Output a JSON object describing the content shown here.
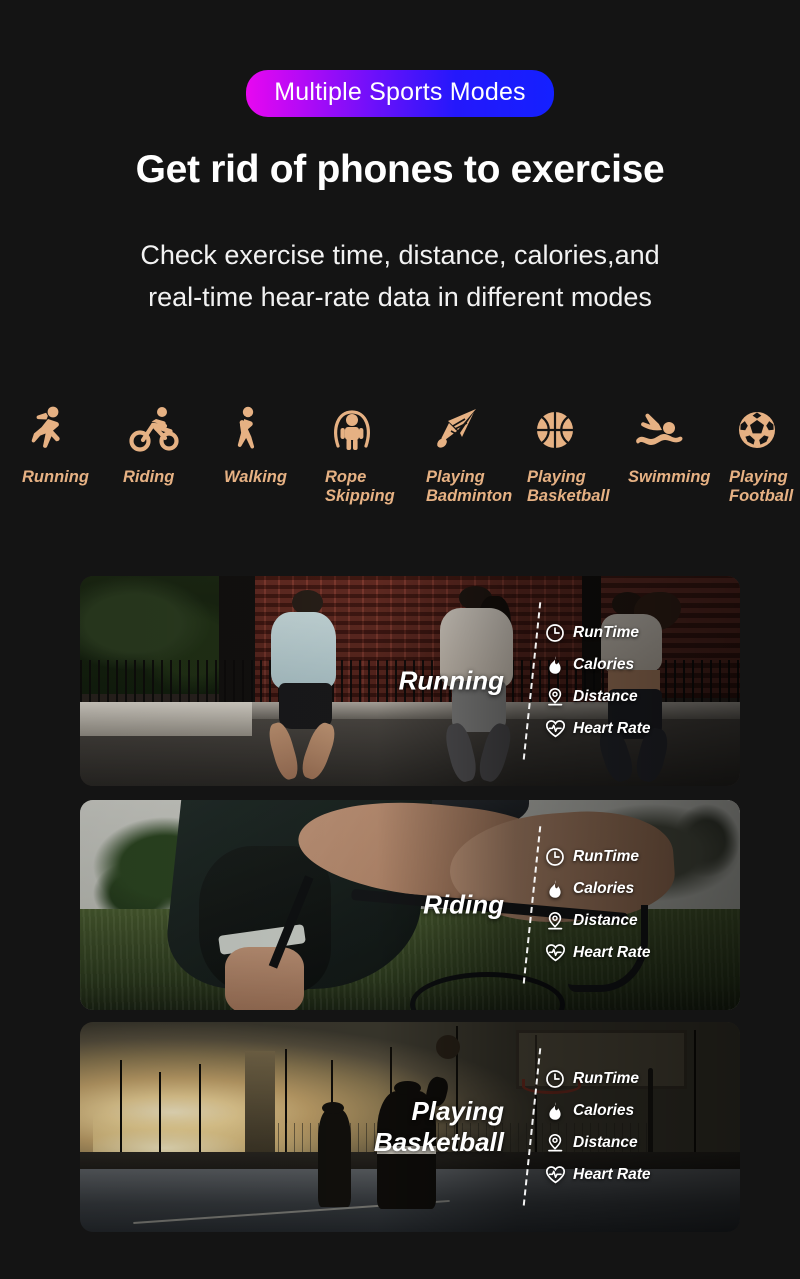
{
  "page": {
    "background_color": "#141414",
    "badge": {
      "label": "Multiple Sports Modes",
      "gradient_from": "#e808f0",
      "gradient_to": "#1420ff",
      "text_color": "#ffffff"
    },
    "headline": "Get rid of phones to exercise",
    "subhead_line1": "Check exercise time, distance, calories,and",
    "subhead_line2": "real-time hear-rate data in different modes",
    "accent_color": "#e6b183"
  },
  "sports": [
    {
      "label": "Running",
      "icon": "running-icon"
    },
    {
      "label": "Riding",
      "icon": "cycling-icon"
    },
    {
      "label": "Walking",
      "icon": "walking-icon"
    },
    {
      "label": "Rope\nSkipping",
      "icon": "rope-skipping-icon"
    },
    {
      "label": "Playing\nBadminton",
      "icon": "badminton-shuttlecock-icon"
    },
    {
      "label": "Playing\nBasketball",
      "icon": "basketball-icon"
    },
    {
      "label": "Swimming",
      "icon": "swimming-icon"
    },
    {
      "label": "Playing\nFootball",
      "icon": "soccer-ball-icon"
    }
  ],
  "cards": [
    {
      "mode": "Running",
      "photo": "runners-on-street-photo",
      "metrics": [
        {
          "label": "RunTime",
          "icon": "clock-icon"
        },
        {
          "label": "Calories",
          "icon": "flame-icon"
        },
        {
          "label": "Distance",
          "icon": "location-pin-icon"
        },
        {
          "label": "Heart Rate",
          "icon": "heart-pulse-icon"
        }
      ]
    },
    {
      "mode": "Riding",
      "photo": "cyclist-in-field-photo",
      "metrics": [
        {
          "label": "RunTime",
          "icon": "clock-icon"
        },
        {
          "label": "Calories",
          "icon": "flame-icon"
        },
        {
          "label": "Distance",
          "icon": "location-pin-icon"
        },
        {
          "label": "Heart Rate",
          "icon": "heart-pulse-icon"
        }
      ]
    },
    {
      "mode": "Playing\nBasketball",
      "photo": "basketball-court-sunset-photo",
      "metrics": [
        {
          "label": "RunTime",
          "icon": "clock-icon"
        },
        {
          "label": "Calories",
          "icon": "flame-icon"
        },
        {
          "label": "Distance",
          "icon": "location-pin-icon"
        },
        {
          "label": "Heart Rate",
          "icon": "heart-pulse-icon"
        }
      ]
    }
  ]
}
